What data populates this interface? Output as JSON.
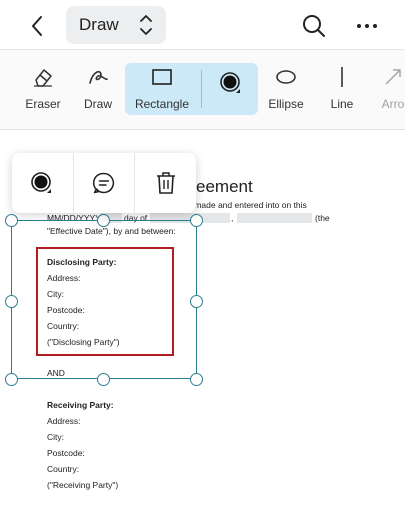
{
  "header": {
    "mode_label": "Draw"
  },
  "toolbar": {
    "tools": [
      {
        "label": "Eraser",
        "icon": "eraser-icon"
      },
      {
        "label": "Draw",
        "icon": "draw-icon"
      },
      {
        "label": "Rectangle",
        "icon": "rectangle-icon",
        "active": true
      },
      {
        "label": "",
        "icon": "color-picker-icon"
      },
      {
        "label": "Ellipse",
        "icon": "ellipse-icon"
      },
      {
        "label": "Line",
        "icon": "line-icon"
      },
      {
        "label": "Arro",
        "icon": "arrow-icon"
      }
    ],
    "active_color": "#cce9f8"
  },
  "popup": {
    "buttons": [
      {
        "icon": "color-picker-icon"
      },
      {
        "icon": "comment-icon"
      },
      {
        "icon": "trash-icon"
      }
    ]
  },
  "document": {
    "heading_fragment": "eement",
    "intro_line_1": "ement\") is made and entered into on this",
    "date_placeholder": "MM/DD/YYYY",
    "day_of": "day of",
    "comma": ",",
    "the": "(the",
    "effective_date": "\"Effective Date\"), by and between:",
    "disclosing": {
      "title": "Disclosing Party:",
      "fields": [
        "Address:",
        "City:",
        "Postcode:",
        "Country:"
      ],
      "alias": "(\"Disclosing Party\")"
    },
    "and": "AND",
    "receiving": {
      "title": "Receiving Party:",
      "fields": [
        "Address:",
        "City:",
        "Postcode:",
        "Country:"
      ],
      "alias": "(\"Receiving Party\")"
    }
  },
  "colors": {
    "annotation_rectangle": "#b01c22",
    "selection": "#2d7f8f"
  }
}
